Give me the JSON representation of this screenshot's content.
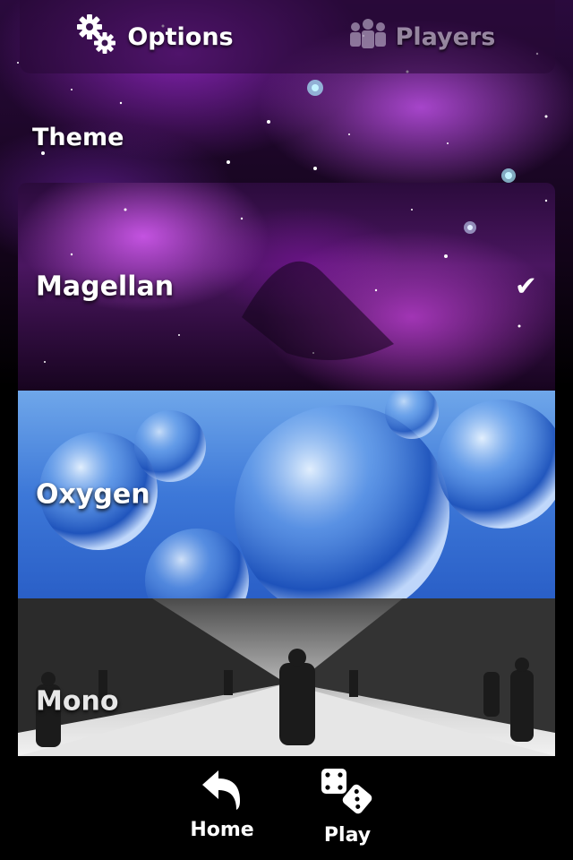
{
  "tabs": {
    "options": {
      "label": "Options",
      "icon": "gears-icon",
      "active": true
    },
    "players": {
      "label": "Players",
      "icon": "group-icon",
      "active": false
    }
  },
  "section": {
    "title": "Theme"
  },
  "themes": [
    {
      "name": "Magellan",
      "selected": true
    },
    {
      "name": "Oxygen",
      "selected": false
    },
    {
      "name": "Mono",
      "selected": false
    }
  ],
  "check_mark": "✔",
  "bottom_bar": {
    "home_label": "Home",
    "play_label": "Play"
  },
  "colors": {
    "accent_purple": "#9b3fc4",
    "oxygen_blue": "#3d78d8",
    "text": "#ffffff"
  }
}
